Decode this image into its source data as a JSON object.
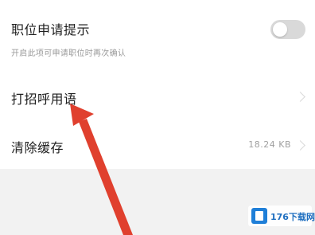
{
  "settings": {
    "job_application_reminder": {
      "title": "职位申请提示",
      "subtitle": "开启此项可申请职位时再次确认",
      "toggle_on": false
    },
    "greeting_phrase": {
      "title": "打招呼用语"
    },
    "clear_cache": {
      "title": "清除缓存",
      "size": "18.24 KB"
    }
  },
  "watermark": {
    "text": "176下载网"
  },
  "colors": {
    "annotation_arrow": "#e0402e",
    "toggle_off": "#d9d9d9",
    "watermark_blue": "#1f7fd8"
  }
}
